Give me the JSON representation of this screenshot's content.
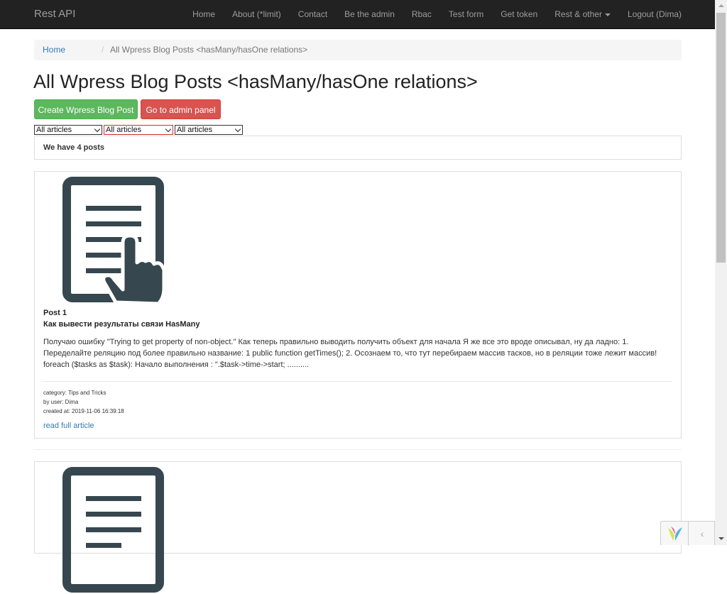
{
  "navbar": {
    "brand": "Rest API",
    "items": [
      {
        "label": "Home"
      },
      {
        "label": "About (*limit)"
      },
      {
        "label": "Contact"
      },
      {
        "label": "Be the admin"
      },
      {
        "label": "Rbac"
      },
      {
        "label": "Test form"
      },
      {
        "label": "Get token"
      },
      {
        "label": "Rest & other"
      },
      {
        "label": "Logout (Dima)"
      }
    ],
    "background": "#222222",
    "text_color": "#9d9d9d"
  },
  "breadcrumb": {
    "home": "Home",
    "separator": "/",
    "active": "All Wpress Blog Posts <hasMany/hasOne relations>"
  },
  "page_title": "All Wpress Blog Posts <hasMany/hasOne relations>",
  "buttons": {
    "create": "Create Wpress Blog Post",
    "admin": "Go to admin panel"
  },
  "filters": [
    {
      "selected": "All articles"
    },
    {
      "selected": "All articles"
    },
    {
      "selected": "All articles"
    }
  ],
  "summary": "We have 4 posts",
  "posts": [
    {
      "icon": "document-pointer-icon",
      "number": "Post 1",
      "title": "Как вывести результаты связи HasMany",
      "excerpt": "Получаю ошибку \"Trying to get property of non-object.\" Как теперь правильно выводить получить объект для начала Я же все это вроде описывал, ну да ладно: 1. Переделайте реляцию под более правильно название: 1 public function getTimes(); 2. Осознаем то, что тут перебираем массив тасков, но в реляции тоже лежит массив! foreach ($tasks as $task): Начало выполнения : \".$task->time->start; ..........",
      "category": "category: Tips and Tricks",
      "user": "by user: Dima",
      "created": "created at: 2019-11-06 16:39:18",
      "read_more": "read full article"
    },
    {
      "icon": "document-pointer-icon"
    }
  ],
  "debug_toolbar": {
    "logo": "yii-logo-icon",
    "toggle": "‹"
  },
  "colors": {
    "success": "#5cb85c",
    "danger": "#d9534f",
    "link": "#337ab7"
  }
}
